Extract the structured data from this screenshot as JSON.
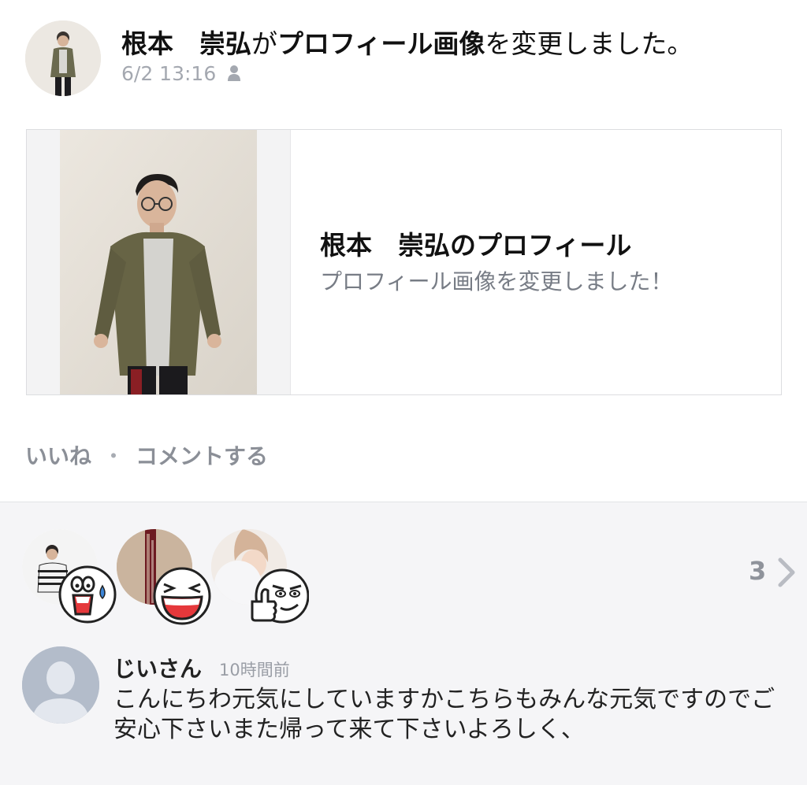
{
  "post": {
    "author_name": "根本　崇弘",
    "action_connector": "が",
    "action_object": "プロフィール画像",
    "action_suffix": "を変更しました。",
    "timestamp": "6/2 13:16",
    "visibility_icon": "person-icon"
  },
  "card": {
    "title": "根本　崇弘のプロフィール",
    "subtitle": "プロフィール画像を変更しました！"
  },
  "actions": {
    "like_label": "いいね",
    "separator": "・",
    "comment_label": "コメントする"
  },
  "likes": {
    "count": "3",
    "chevron_icon": "chevron-right-icon",
    "stickers": [
      "shocked-sweat-sticker",
      "laughing-sticker",
      "thumbs-up-smirk-sticker"
    ]
  },
  "comment": {
    "name": "じいさん",
    "time": "10時間前",
    "text": "こんにちわ元気にしていますかこちらもみんな元気ですのでご安心下さいまた帰って来て下さいよろしく、"
  },
  "colors": {
    "muted_text": "#a4a8b0",
    "social_bg": "#f5f5f7",
    "card_border": "#dcdde0"
  }
}
